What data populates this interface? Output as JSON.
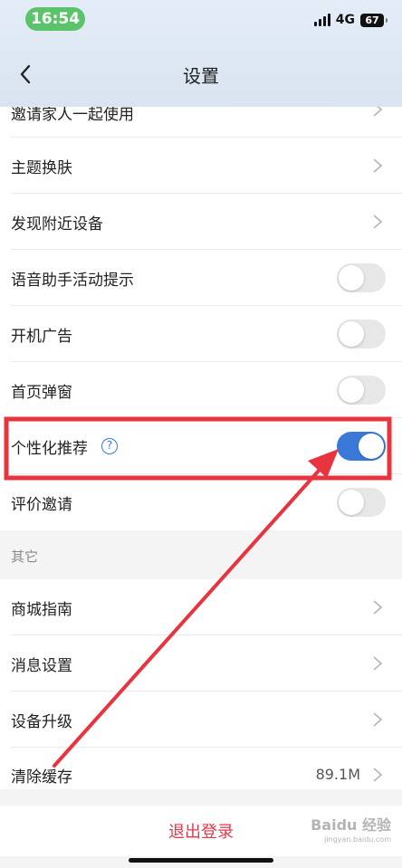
{
  "status_bar": {
    "time": "16:54",
    "network": "4G",
    "battery": "67"
  },
  "header": {
    "title": "设置"
  },
  "rows": [
    {
      "label": "邀请家人一起使用",
      "control": "chevron"
    },
    {
      "label": "主题换肤",
      "control": "chevron"
    },
    {
      "label": "发现附近设备",
      "control": "chevron"
    },
    {
      "label": "语音助手活动提示",
      "control": "toggle",
      "on": false
    },
    {
      "label": "开机广告",
      "control": "toggle",
      "on": false
    },
    {
      "label": "首页弹窗",
      "control": "toggle",
      "on": false
    },
    {
      "label": "个性化推荐",
      "control": "toggle",
      "on": true,
      "help": "?"
    },
    {
      "label": "评价邀请",
      "control": "toggle",
      "on": false
    }
  ],
  "other_section": {
    "title": "其它",
    "rows": [
      {
        "label": "商城指南"
      },
      {
        "label": "消息设置"
      },
      {
        "label": "设备升级"
      },
      {
        "label": "清除缓存",
        "value": "89.1M"
      }
    ]
  },
  "logout": {
    "label": "退出登录"
  },
  "watermark": {
    "text": "Baidu 经验",
    "sub": "jingyan.baidu.com"
  },
  "colors": {
    "accent": "#3a79d8",
    "danger": "#e1394b",
    "annotation": "#e8343f",
    "status_green": "#5bc46a"
  }
}
